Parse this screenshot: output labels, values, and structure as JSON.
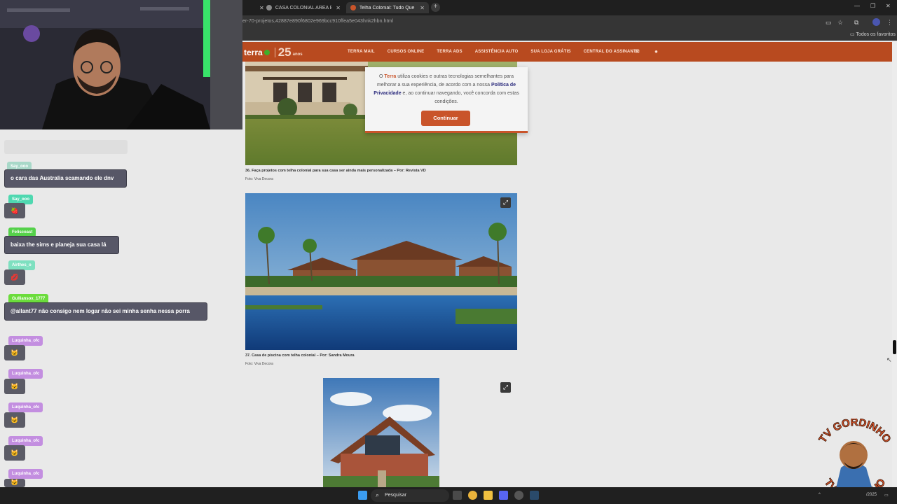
{
  "browser": {
    "tabs": [
      {
        "title": "CASA COLONIAL AREA EXTER",
        "active": false
      },
      {
        "title": "Telha Colonial: Tudo Que Você",
        "active": true
      }
    ],
    "url": "er-70-projetos,42887e890f6802e969bcc910ffea5e043hnk2hbn.html",
    "bookmarks_label": "Todos os favoritos"
  },
  "site": {
    "logo_text": "terra",
    "logo_anniversary": "25",
    "logo_anos": "anos",
    "nav": [
      "TERRA MAIL",
      "CURSOS ONLINE",
      "TERRA ADS",
      "ASSISTÊNCIA AUTO",
      "SUA LOJA GRÁTIS",
      "CENTRAL DO ASSINANTE"
    ],
    "colors": {
      "brand": "#b84a1f",
      "button": "#c9542a"
    }
  },
  "cookie": {
    "t1": "O ",
    "brand": "Terra",
    "t2": " utiliza cookies e outras tecnologias semelhantes para melhorar a sua experiência, de acordo com a nossa ",
    "link": "Política de Privacidade",
    "t3": " e, ao continuar navegando, você concorda com estas condições.",
    "button": "Continuar"
  },
  "article": {
    "items": [
      {
        "caption": "36. Faça projetos com telha colonial para sua casa ser ainda mais personalizada – Por: Revista VD",
        "credit": "Foto: Viva Decora"
      },
      {
        "caption": "37. Casa de piscina com telha colonial – Por: Sandra Moura",
        "credit": "Foto: Viva Decora"
      }
    ],
    "expand_icon": "expand-icon"
  },
  "chat": {
    "messages": [
      {
        "user": "Say_ooo",
        "text": "o cara das Australia scamando ele dnv",
        "user_color": "#a8d8c8"
      },
      {
        "user": "Say_ooo",
        "text": "",
        "user_color": "#4fd8b0"
      },
      {
        "user": "Feliscoast",
        "text": "baixa the sims e planeja sua casa lá",
        "user_color": "#55d14a"
      },
      {
        "user": "Airthes_o",
        "text": "",
        "user_color": "#7ee0c0"
      },
      {
        "user": "Gulliansox_1777",
        "text": "@allant77 não consigo nem logar não sei minha senha nessa porra",
        "user_color": "#6bdc3c"
      },
      {
        "user": "Luquinha_ofc",
        "text": "",
        "user_color": "#c38ee0"
      },
      {
        "user": "Luquinha_ofc",
        "text": "",
        "user_color": "#c38ee0"
      },
      {
        "user": "Luquinha_ofc",
        "text": "",
        "user_color": "#c38ee0"
      },
      {
        "user": "Luquinha_ofc",
        "text": "",
        "user_color": "#c38ee0"
      },
      {
        "user": "Luquinha_ofc",
        "text": "",
        "user_color": "#c38ee0"
      }
    ]
  },
  "taskbar": {
    "search_placeholder": "Pesquisar",
    "clock": "/2025"
  },
  "watermark": {
    "text_top": "TV GORDINHO",
    "text_bottom": "TV GORDINHO"
  }
}
